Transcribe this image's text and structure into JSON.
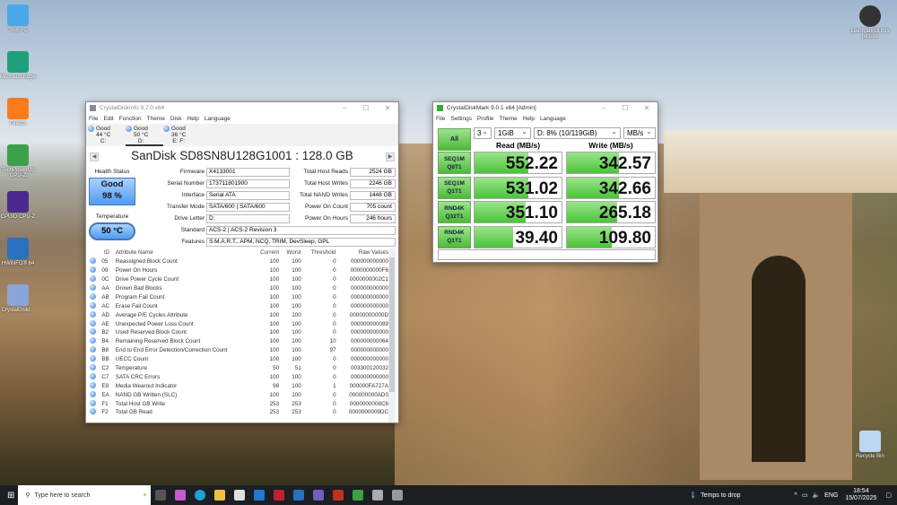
{
  "desktop": {
    "icons": [
      {
        "label": "This PC",
        "color": "#4aa8e8"
      },
      {
        "label": "Microsoft Edge",
        "color": "#1fa07a"
      },
      {
        "label": "Firefox",
        "color": "#ff7a1a"
      },
      {
        "label": "TechPowerUp GPU-Z",
        "color": "#3aa04a"
      },
      {
        "label": "CPUID CPU-Z",
        "color": "#4a2a90"
      },
      {
        "label": "HWiNFO® 64",
        "color": "#2a70c0"
      },
      {
        "label": "CrystalDiskI...",
        "color": "#8aa6d8"
      }
    ],
    "learn_label": "Learn about this picture",
    "recycle_label": "Recycle Bin"
  },
  "cdi": {
    "title": "CrystalDiskInfo 9.7.0 x64",
    "menu": [
      "File",
      "Edit",
      "Function",
      "Theme",
      "Disk",
      "Help",
      "Language"
    ],
    "disks": [
      {
        "status": "Good",
        "temp": "44 °C",
        "letter": "C:"
      },
      {
        "status": "Good",
        "temp": "50 °C",
        "letter": "D:"
      },
      {
        "status": "Good",
        "temp": "36 °C",
        "letter": "E: F:"
      }
    ],
    "model": "SanDisk SD8SN8U128G1001 : 128.0 GB",
    "health_label": "Health Status",
    "health_status": "Good",
    "health_pct": "98 %",
    "temp_label": "Temperature",
    "temp": "50 °C",
    "left_fields": [
      {
        "label": "Firmware",
        "value": "X4133001"
      },
      {
        "label": "Serial Number",
        "value": "173711801900"
      },
      {
        "label": "Interface",
        "value": "Serial ATA"
      },
      {
        "label": "Transfer Mode",
        "value": "SATA/600 | SATA/600"
      },
      {
        "label": "Drive Letter",
        "value": "D:"
      }
    ],
    "right_fields": [
      {
        "label": "Total Host Reads",
        "value": "2524 GB"
      },
      {
        "label": "Total Host Writes",
        "value": "2246 GB"
      },
      {
        "label": "Total NAND Writes",
        "value": "1448 GB"
      },
      {
        "label": "Power On Count",
        "value": "705 count"
      },
      {
        "label": "Power On Hours",
        "value": "246 hours"
      }
    ],
    "standard_label": "Standard",
    "standard": "ACS-2 | ACS-2 Revision 3",
    "features_label": "Features",
    "features": "S.M.A.R.T., APM, NCQ, TRIM, DevSleep, GPL",
    "columns": [
      "ID",
      "Attribute Name",
      "Current",
      "Worst",
      "Threshold",
      "Raw Values"
    ],
    "rows": [
      [
        "05",
        "Reassigned Block Count",
        "100",
        "100",
        "0",
        "000000000000"
      ],
      [
        "09",
        "Power On Hours",
        "100",
        "100",
        "0",
        "0000000000F6"
      ],
      [
        "0C",
        "Drive Power Cycle Count",
        "100",
        "100",
        "0",
        "0000000002C1"
      ],
      [
        "AA",
        "Grown Bad Blocks",
        "100",
        "100",
        "0",
        "000000000000"
      ],
      [
        "AB",
        "Program Fail Count",
        "100",
        "100",
        "0",
        "000000000000"
      ],
      [
        "AC",
        "Erase Fail Count",
        "100",
        "100",
        "0",
        "000000000000"
      ],
      [
        "AD",
        "Average P/E Cycles Attribute",
        "100",
        "100",
        "0",
        "00000000000D"
      ],
      [
        "AE",
        "Unexpected Power Loss Count",
        "100",
        "100",
        "0",
        "000000000089"
      ],
      [
        "B2",
        "Used Reserved Block Count",
        "100",
        "100",
        "0",
        "000000000000"
      ],
      [
        "B4",
        "Remaining Reserved Block Count",
        "100",
        "100",
        "10",
        "000000000064"
      ],
      [
        "B8",
        "End to End Error Detection/Correction Count",
        "100",
        "100",
        "97",
        "000000000000"
      ],
      [
        "BB",
        "UECC Count",
        "100",
        "100",
        "0",
        "000000000000"
      ],
      [
        "C2",
        "Temperature",
        "50",
        "51",
        "0",
        "003300120032"
      ],
      [
        "C7",
        "SATA CRC Errors",
        "100",
        "100",
        "0",
        "000000000000"
      ],
      [
        "E9",
        "Media Wearout Indicator",
        "98",
        "100",
        "1",
        "000000FA727A"
      ],
      [
        "EA",
        "NAND GB Written (SLC)",
        "100",
        "100",
        "0",
        "000000000AD0"
      ],
      [
        "F1",
        "Total Host GB Write",
        "253",
        "253",
        "0",
        "0000000008C6"
      ],
      [
        "F2",
        "Total GB Read",
        "253",
        "253",
        "0",
        "0000000009DC"
      ]
    ]
  },
  "cdm": {
    "title": "CrystalDiskMark 9.0.1 x64 [Admin]",
    "menu": [
      "File",
      "Settings",
      "Profile",
      "Theme",
      "Help",
      "Language"
    ],
    "all_label": "All",
    "count": "3",
    "size": "1GiB",
    "drive": "D: 8% (10/119GiB)",
    "unit": "MB/s",
    "read_header": "Read (MB/s)",
    "write_header": "Write (MB/s)",
    "tests": [
      {
        "l1": "SEQ1M",
        "l2": "Q8T1",
        "read": "552.22",
        "write": "342.57"
      },
      {
        "l1": "SEQ1M",
        "l2": "Q1T1",
        "read": "531.02",
        "write": "342.66"
      },
      {
        "l1": "RND4K",
        "l2": "Q32T1",
        "read": "351.10",
        "write": "265.18"
      },
      {
        "l1": "RND4K",
        "l2": "Q1T1",
        "read": "39.40",
        "write": "109.80"
      }
    ],
    "accent": "#4cc33a"
  },
  "taskbar": {
    "search_placeholder": "Type here to search",
    "weather": "Temps to drop",
    "lang": "ENG",
    "time": "18:54",
    "date": "15/07/2025"
  }
}
